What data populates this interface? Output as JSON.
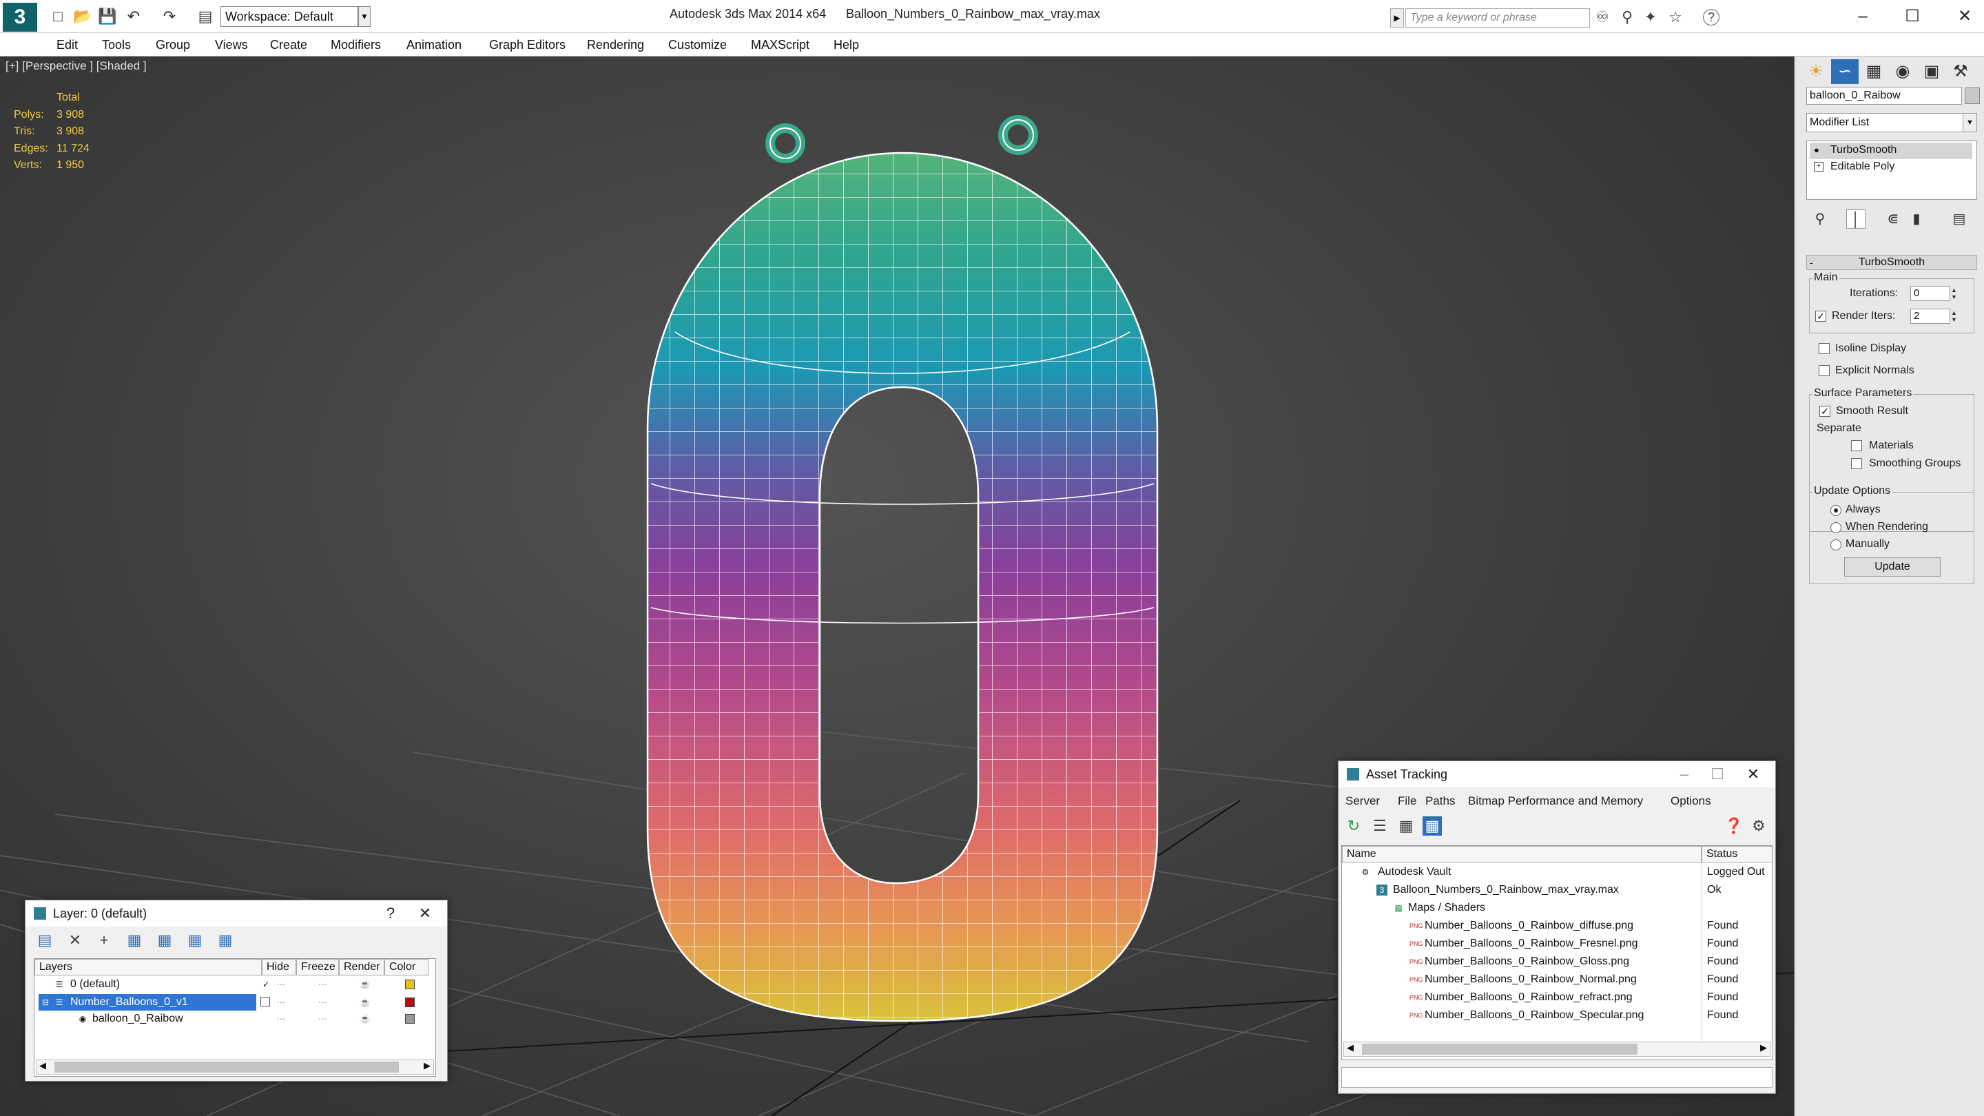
{
  "title_bar": {
    "app_title": "Autodesk 3ds Max  2014 x64",
    "file_name": "Balloon_Numbers_0_Rainbow_max_vray.max",
    "workspace": "Workspace: Default",
    "search_placeholder": "Type a keyword or phrase",
    "help": "?"
  },
  "menu": [
    "Edit",
    "Tools",
    "Group",
    "Views",
    "Create",
    "Modifiers",
    "Animation",
    "Graph Editors",
    "Rendering",
    "Customize",
    "MAXScript",
    "Help"
  ],
  "viewport": {
    "label": "[+] [Perspective ] [Shaded ]",
    "stats_header": "Total",
    "stats": [
      {
        "k": "Polys:",
        "v": "3 908"
      },
      {
        "k": "Tris:",
        "v": "3 908"
      },
      {
        "k": "Edges:",
        "v": "11 724"
      },
      {
        "k": "Verts:",
        "v": "1 950"
      }
    ]
  },
  "command_panel": {
    "object_name": "balloon_0_Raibow",
    "modifier_list": "Modifier List",
    "stack": [
      "TurboSmooth",
      "Editable Poly"
    ],
    "rollout_title": "TurboSmooth",
    "main_label": "Main",
    "iterations_label": "Iterations:",
    "iterations_value": "0",
    "render_iters_label": "Render Iters:",
    "render_iters_value": "2",
    "isoline": "Isoline Display",
    "explicit": "Explicit Normals",
    "surface_label": "Surface Parameters",
    "smooth_result": "Smooth Result",
    "separate": "Separate",
    "materials": "Materials",
    "smoothing_groups": "Smoothing Groups",
    "update_label": "Update Options",
    "always": "Always",
    "when_rendering": "When Rendering",
    "manually": "Manually",
    "update_button": "Update"
  },
  "layer_dialog": {
    "title": "Layer: 0 (default)",
    "help": "?",
    "columns": [
      "Layers",
      "Hide",
      "Freeze",
      "Render",
      "Color"
    ],
    "rows": [
      {
        "name": "0 (default)",
        "color": "#e8c020"
      },
      {
        "name": "Number_Balloons_0_v1",
        "color": "#b01010"
      },
      {
        "name": "balloon_0_Raibow",
        "color": "#9a9a9a"
      }
    ]
  },
  "asset_dialog": {
    "title": "Asset Tracking",
    "menu": [
      "Server",
      "File",
      "Paths",
      "Bitmap Performance and Memory",
      "Options"
    ],
    "columns": [
      "Name",
      "Status"
    ],
    "rows": [
      {
        "name": "Autodesk Vault",
        "status": "Logged Out"
      },
      {
        "name": "Balloon_Numbers_0_Rainbow_max_vray.max",
        "status": "Ok"
      },
      {
        "name": "Maps / Shaders",
        "status": ""
      },
      {
        "name": "Number_Balloons_0_Rainbow_diffuse.png",
        "status": "Found"
      },
      {
        "name": "Number_Balloons_0_Rainbow_Fresnel.png",
        "status": "Found"
      },
      {
        "name": "Number_Balloons_0_Rainbow_Gloss.png",
        "status": "Found"
      },
      {
        "name": "Number_Balloons_0_Rainbow_Normal.png",
        "status": "Found"
      },
      {
        "name": "Number_Balloons_0_Rainbow_refract.png",
        "status": "Found"
      },
      {
        "name": "Number_Balloons_0_Rainbow_Specular.png",
        "status": "Found"
      }
    ]
  }
}
